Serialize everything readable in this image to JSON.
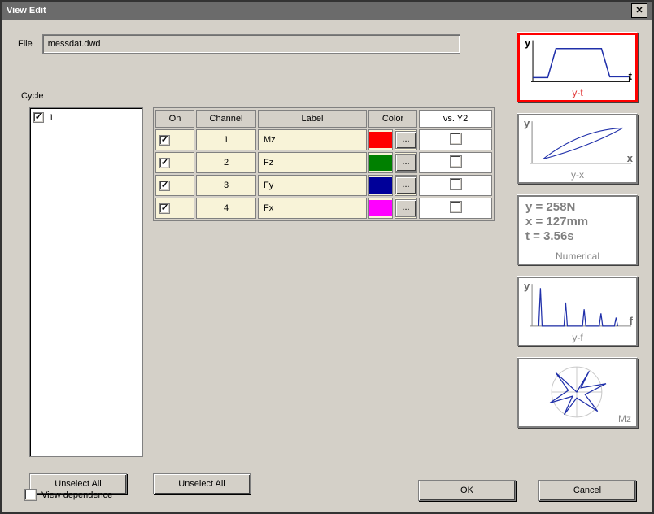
{
  "title": "View Edit",
  "file": {
    "label": "File",
    "value": "messdat.dwd"
  },
  "cycle": {
    "label": "Cycle",
    "items": [
      {
        "label": "1",
        "checked": true
      }
    ]
  },
  "table": {
    "headers": {
      "on": "On",
      "channel": "Channel",
      "label": "Label",
      "color": "Color",
      "vsy2": "vs. Y2"
    },
    "rows": [
      {
        "on": true,
        "channel": "1",
        "label": "Mz",
        "color": "#ff0000",
        "vsy2": false
      },
      {
        "on": true,
        "channel": "2",
        "label": "Fz",
        "color": "#008000",
        "vsy2": false
      },
      {
        "on": true,
        "channel": "3",
        "label": "Fy",
        "color": "#000099",
        "vsy2": false
      },
      {
        "on": true,
        "channel": "4",
        "label": "Fx",
        "color": "#ff00ff",
        "vsy2": false
      }
    ],
    "ellipsis": "..."
  },
  "viewButtons": {
    "yt": {
      "axisX": "t",
      "caption": "y-t"
    },
    "yx": {
      "axisX": "x",
      "caption": "y-x"
    },
    "num": {
      "line1": "y = 258N",
      "line2": "x = 127mm",
      "line3": "t = 3.56s",
      "caption": "Numerical"
    },
    "yf": {
      "axisX": "f",
      "caption": "y-f"
    },
    "polar": {
      "caption": "Mz"
    }
  },
  "buttons": {
    "unselect1": "Unselect All",
    "unselect2": "Unselect All",
    "ok": "OK",
    "cancel": "Cancel"
  },
  "viewDependence": {
    "label": "View dependence",
    "checked": false
  },
  "axisY": "y"
}
